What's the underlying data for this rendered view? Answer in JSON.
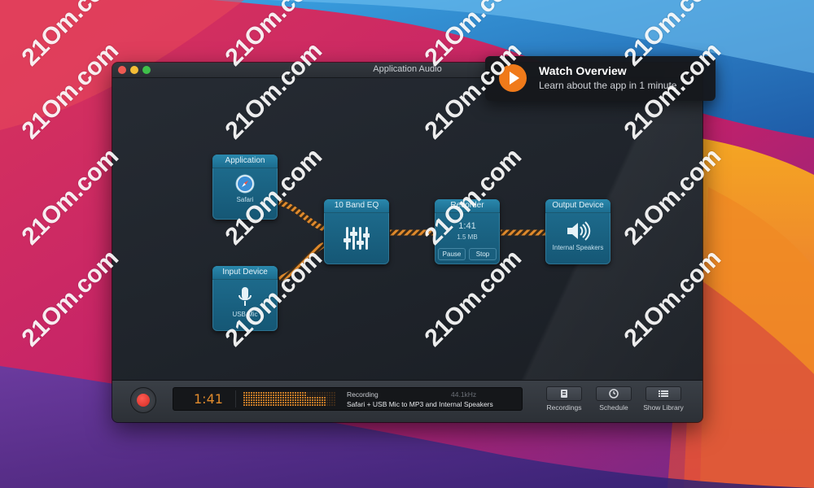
{
  "window": {
    "title": "Application Audio"
  },
  "nodes": {
    "application": {
      "title": "Application",
      "source": "Safari"
    },
    "input_device": {
      "title": "Input Device",
      "source": "USB Mic"
    },
    "eq": {
      "title": "10 Band EQ"
    },
    "recorder": {
      "title": "Recorder",
      "time": "1:41",
      "size": "1.5 MB",
      "pause_label": "Pause",
      "stop_label": "Stop"
    },
    "output_device": {
      "title": "Output Device",
      "source": "Internal Speakers"
    }
  },
  "bottombar": {
    "timer": "1:41",
    "status": "Recording",
    "sample_rate": "44.1kHz",
    "route": "Safari + USB Mic to MP3 and Internal Speakers",
    "buttons": {
      "recordings": "Recordings",
      "schedule": "Schedule",
      "show_library": "Show Library"
    }
  },
  "notification": {
    "title": "Watch Overview",
    "subtitle": "Learn about the app in 1 minute"
  },
  "watermark_text": "21Om.com",
  "colors": {
    "node_blue": "#1f6f91",
    "wire_orange": "#e08a2c",
    "record_red": "#e0342b",
    "play_orange": "#f07a1a"
  },
  "icons": [
    "compass-icon",
    "microphone-icon",
    "equalizer-icon",
    "speaker-icon",
    "record-icon",
    "play-icon",
    "recordings-icon",
    "clock-icon",
    "list-icon"
  ]
}
